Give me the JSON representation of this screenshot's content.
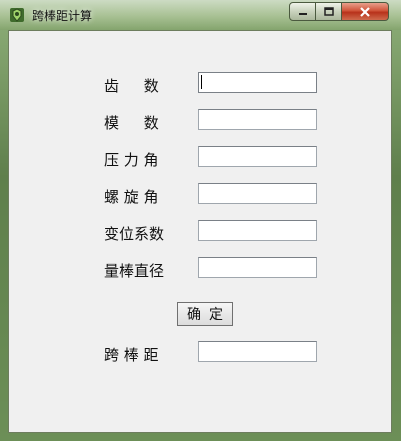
{
  "window": {
    "title": "跨棒距计算",
    "minimize_glyph": "▁",
    "maximize_glyph": "□",
    "close_glyph": "✕"
  },
  "form": {
    "teeth_label": "齿    数",
    "teeth_value": "",
    "module_label": "模    数",
    "module_value": "",
    "pressure_angle_label": "压 力 角",
    "pressure_angle_value": "",
    "helix_angle_label": "螺 旋 角",
    "helix_angle_value": "",
    "shift_coeff_label": "变位系数",
    "shift_coeff_value": "",
    "rod_diameter_label": "量棒直径",
    "rod_diameter_value": "",
    "confirm_button": "确定",
    "over_pin_label": "跨 棒 距",
    "over_pin_value": ""
  }
}
